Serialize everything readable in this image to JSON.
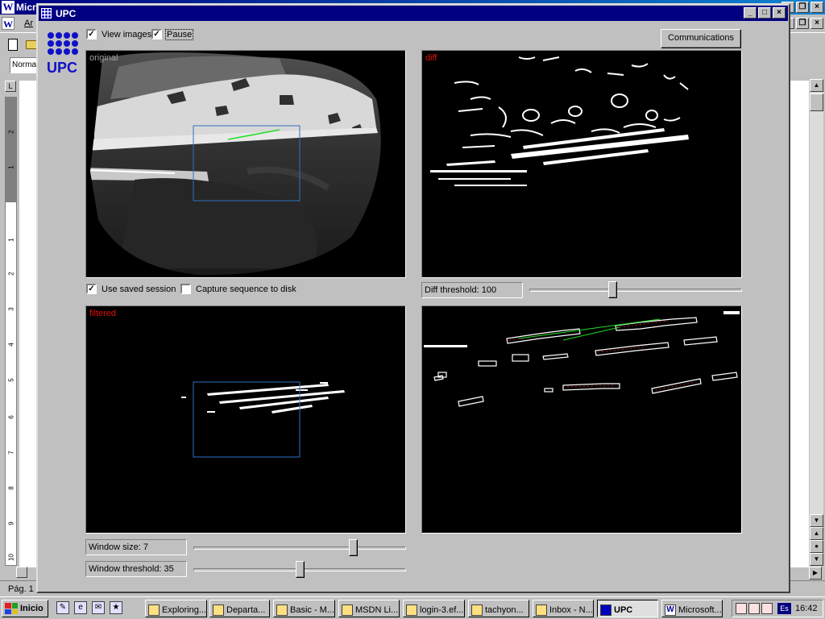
{
  "background_app": {
    "title": "Micr",
    "menu_item": "Ar",
    "style_box": "Norma",
    "status_text": "Pág. 1",
    "ruler_numbers": [
      "2",
      "1",
      "1",
      "1",
      "2",
      "3",
      "4",
      "5",
      "6",
      "7",
      "8",
      "9",
      "10"
    ]
  },
  "window": {
    "title": "UPC",
    "minimize": "_",
    "maximize": "□",
    "close": "×"
  },
  "logo": {
    "text": "UPC"
  },
  "options": {
    "view_images": {
      "label": "View images",
      "checked": true
    },
    "pause": {
      "label": "Pause",
      "checked": true
    },
    "use_saved_session": {
      "label": "Use saved session",
      "checked": true
    },
    "capture_sequence": {
      "label": "Capture sequence to disk",
      "checked": false
    }
  },
  "communications_button": "Communications",
  "panels": {
    "original": {
      "label": "original",
      "label_color": "#a0a0a0"
    },
    "diff": {
      "label": "diff",
      "label_color": "#e01010"
    },
    "filtered": {
      "label": "filtered",
      "label_color": "#e01010"
    },
    "tracking": {
      "label": ""
    }
  },
  "controls": {
    "diff_threshold": {
      "label": "Diff threshold: 100",
      "value": 100,
      "position": 0.39
    },
    "window_size": {
      "label": "Window size: 7",
      "value": 7,
      "position": 0.75
    },
    "window_threshold": {
      "label": "Window threshold: 35",
      "value": 35,
      "position": 0.5
    }
  },
  "taskbar": {
    "start": "Inicio",
    "tasks": [
      {
        "label": "Exploring...",
        "active": false
      },
      {
        "label": "Departa...",
        "active": false
      },
      {
        "label": "Basic - M...",
        "active": false
      },
      {
        "label": "MSDN Li...",
        "active": false
      },
      {
        "label": "login-3.ef...",
        "active": false
      },
      {
        "label": "tachyon...",
        "active": false
      },
      {
        "label": "Inbox - N...",
        "active": false
      },
      {
        "label": "UPC",
        "active": true
      },
      {
        "label": "Microsoft...",
        "active": false
      }
    ],
    "language": "Es",
    "clock": "16:42"
  },
  "colors": {
    "title_bar": "#000080",
    "logo_blue": "#1010c8",
    "roi_box": "#3070c0",
    "track_line": "#20e020"
  }
}
